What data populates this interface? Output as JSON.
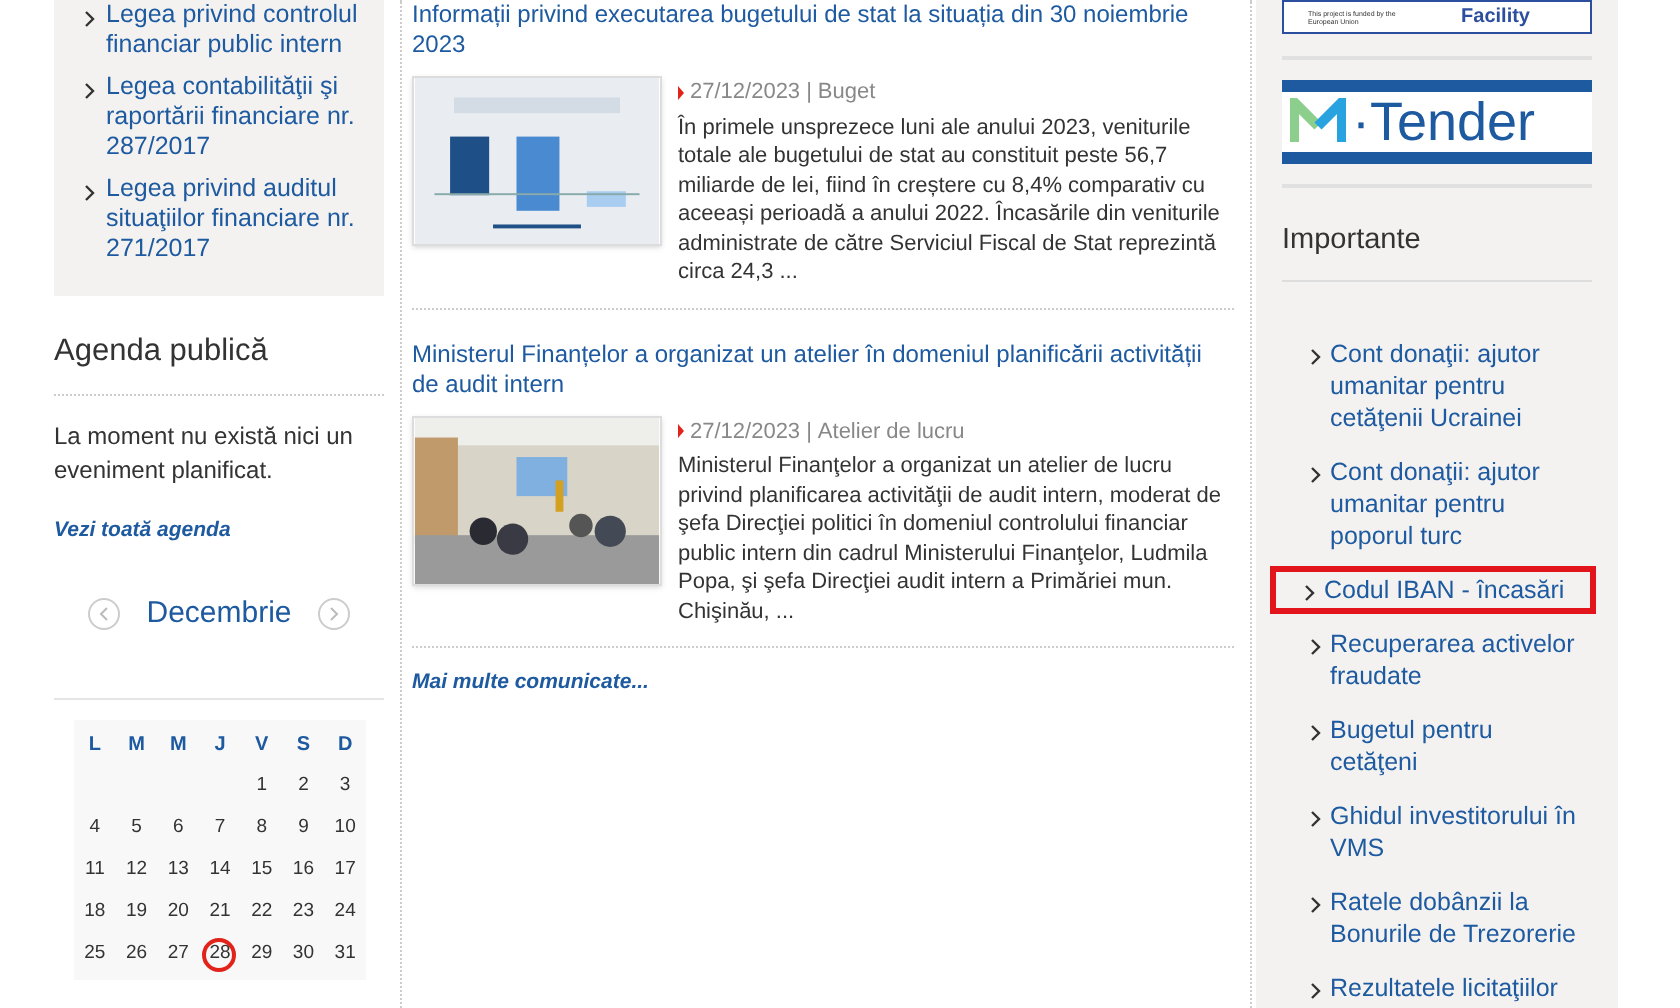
{
  "left_links": [
    {
      "text": "Legea privind controlul financiar public intern"
    },
    {
      "text": "Legea contabilităţii şi raportării financiare nr. 287/2017"
    },
    {
      "text": "Legea privind auditul situaţiilor financiare nr. 271/2017"
    }
  ],
  "agenda": {
    "title": "Agenda publică",
    "message": "La moment nu există nici un eveniment planificat.",
    "link": "Vezi toată agenda"
  },
  "calendar": {
    "month": "Decembrie",
    "weekdays": [
      "L",
      "M",
      "M",
      "J",
      "V",
      "S",
      "D"
    ],
    "days": [
      {
        "day": "1",
        "selected": false
      },
      {
        "day": "2",
        "selected": false
      },
      {
        "day": "3",
        "selected": false
      },
      {
        "day": "4",
        "selected": false
      },
      {
        "day": "5",
        "selected": false
      },
      {
        "day": "6",
        "selected": false
      },
      {
        "day": "7",
        "selected": false
      },
      {
        "day": "8",
        "selected": false
      },
      {
        "day": "9",
        "selected": false
      },
      {
        "day": "10",
        "selected": false
      },
      {
        "day": "11",
        "selected": false
      },
      {
        "day": "12",
        "selected": false
      },
      {
        "day": "13",
        "selected": false
      },
      {
        "day": "14",
        "selected": false
      },
      {
        "day": "15",
        "selected": false
      },
      {
        "day": "16",
        "selected": false
      },
      {
        "day": "17",
        "selected": false
      },
      {
        "day": "18",
        "selected": false
      },
      {
        "day": "19",
        "selected": false
      },
      {
        "day": "20",
        "selected": false
      },
      {
        "day": "21",
        "selected": false
      },
      {
        "day": "22",
        "selected": false
      },
      {
        "day": "23",
        "selected": false
      },
      {
        "day": "24",
        "selected": false
      },
      {
        "day": "25",
        "selected": false
      },
      {
        "day": "26",
        "selected": false
      },
      {
        "day": "27",
        "selected": false
      },
      {
        "day": "28",
        "selected": true
      },
      {
        "day": "29",
        "selected": false
      },
      {
        "day": "30",
        "selected": false
      },
      {
        "day": "31",
        "selected": false
      }
    ]
  },
  "news": [
    {
      "title": "Informații privind executarea bugetului de stat la situația din 30 noiembrie 2023",
      "date": "27/12/2023",
      "separator": "|",
      "category": "Buget",
      "summary": "În primele unsprezece luni ale anului 2023, veniturile totale ale bugetului de stat au constituit peste 56,7 miliarde de lei, fiind în creștere cu 8,4% comparativ cu aceeași perioadă a anului 2022. Încasările din veniturile administrate de către Serviciul Fiscal de Stat reprezintă circa 24,3 ..."
    },
    {
      "title": "Ministerul Finanțelor a organizat un atelier în domeniul planificării activității de audit intern",
      "date": "27/12/2023",
      "separator": "|",
      "category": "Atelier de lucru",
      "summary": "Ministerul Finanţelor a organizat un atelier de lucru privind planificarea activităţii de audit intern, moderat de şefa Direcţiei politici în domeniul controlului financiar public intern din cadrul Ministerului Finanţelor, Ludmila Popa, şi şefa Direcţiei audit intern a Primăriei mun. Chişinău, ..."
    }
  ],
  "more_link": "Mai multe comunicate...",
  "banners": {
    "eu_note": "This project is funded by the European Union",
    "facility": "Facility",
    "tender": "·Tender"
  },
  "important": {
    "title": "Importante",
    "items": [
      {
        "text": "Cont donaţii: ajutor umanitar pentru cetăţenii Ucrainei",
        "highlighted": false
      },
      {
        "text": "Cont donaţii: ajutor umanitar pentru poporul turc",
        "highlighted": false
      },
      {
        "text": "Codul IBAN - încasări",
        "highlighted": true
      },
      {
        "text": "Recuperarea activelor fraudate",
        "highlighted": false
      },
      {
        "text": "Bugetul pentru cetăţeni",
        "highlighted": false
      },
      {
        "text": "Ghidul investitorului în VMS",
        "highlighted": false
      },
      {
        "text": "Ratele dobânzii la Bonurile de Trezorerie",
        "highlighted": false
      },
      {
        "text": "Rezultatele licitaţiilor",
        "highlighted": false
      }
    ]
  }
}
